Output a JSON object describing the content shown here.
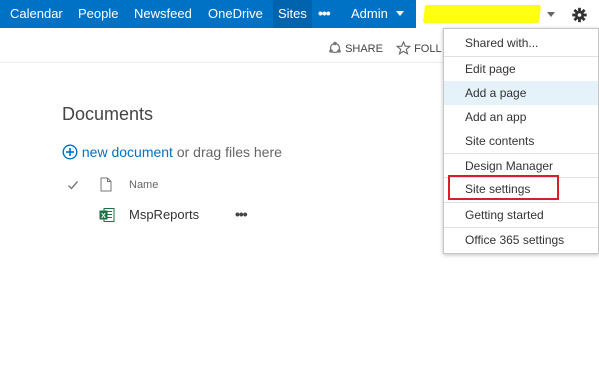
{
  "nav": {
    "items": [
      {
        "label": "Calendar"
      },
      {
        "label": "People"
      },
      {
        "label": "Newsfeed"
      },
      {
        "label": "OneDrive"
      },
      {
        "label": "Sites"
      }
    ],
    "more_label": "•••",
    "admin_label": "Admin"
  },
  "ribbon": {
    "share_label": "SHARE",
    "follow_label": "FOLL"
  },
  "documents": {
    "title": "Documents",
    "new_document_label": "new document",
    "drag_hint": " or drag files here",
    "column_name": "Name",
    "files": [
      {
        "name": "MspReports",
        "more": "•••"
      }
    ]
  },
  "menu": {
    "items": [
      {
        "label": "Shared with..."
      },
      {
        "label": "Edit page"
      },
      {
        "label": "Add a page"
      },
      {
        "label": "Add an app"
      },
      {
        "label": "Site contents"
      },
      {
        "label": "Design Manager"
      },
      {
        "label": "Site settings"
      },
      {
        "label": "Getting started"
      },
      {
        "label": "Office 365 settings"
      }
    ]
  },
  "colors": {
    "suitebar": "#0072c6",
    "active_tab": "#0063ad",
    "link": "#0072c6",
    "highlight_marker": "#ffff14",
    "callout_box": "#d81e2c",
    "menu_hover": "#e6f2fa"
  },
  "icons": {
    "settings": "gear-icon",
    "share": "share-icon",
    "follow": "star-icon",
    "new_document": "plus-circle-icon",
    "check": "check-icon",
    "file_type": "document-icon",
    "excel": "excel-icon"
  }
}
